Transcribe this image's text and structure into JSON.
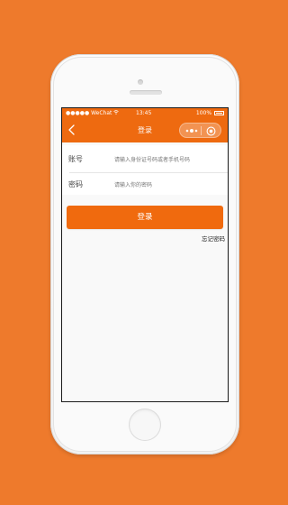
{
  "status_bar": {
    "carrier": "●●●●● WeChat",
    "wifi_icon": "wifi-icon",
    "time": "13:45",
    "battery_text": "100%"
  },
  "nav": {
    "title": "登录",
    "back_icon": "chevron-left-icon",
    "capsule_more_icon": "dots-icon",
    "capsule_close_icon": "target-icon"
  },
  "form": {
    "account": {
      "label": "账号",
      "placeholder": "请输入身份证号码或者手机号码"
    },
    "password": {
      "label": "密码",
      "placeholder": "请输入你的密码"
    }
  },
  "login_button_label": "登录",
  "forgot_password_label": "忘记密码",
  "colors": {
    "background": "#ee7a2c",
    "accent": "#ee6a10"
  }
}
